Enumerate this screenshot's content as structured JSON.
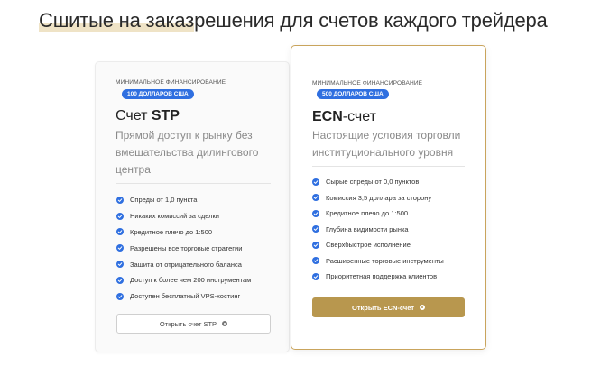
{
  "headline": {
    "highlight": "Сшитые на заказ",
    "rest": "решения для счетов каждого трейдера"
  },
  "cards": {
    "stp": {
      "min_label": "МИНИМАЛЬНОЕ ФИНАНСИРОВАНИЕ",
      "badge": "100 ДОЛЛАРОВ США",
      "title_prefix": "Счет ",
      "title_bold": "STP",
      "subtitle": "Прямой доступ к рынку без вмешательства дилингового центра",
      "features": [
        "Спреды от 1,0 пункта",
        "Никаких комиссий за сделки",
        "Кредитное плечо до 1:500",
        "Разрешены все торговые стратегии",
        "Защита от отрицательного баланса",
        "Доступ к более чем 200 инструментам",
        "Доступен бесплатный VPS-хостинг"
      ],
      "button": "Открыть счет STP"
    },
    "ecn": {
      "min_label": "МИНИМАЛЬНОЕ ФИНАНСИРОВАНИЕ",
      "badge": "500 ДОЛЛАРОВ США",
      "title_bold": "ECN",
      "title_suffix": "-счет",
      "subtitle": "Настоящие условия торговли институционального уровня",
      "features": [
        "Сырые спреды от 0,0 пунктов",
        "Комиссия 3,5 доллара за сторону",
        "Кредитное плечо до 1:500",
        "Глубина видимости рынка",
        "Сверхбыстрое исполнение",
        "Расширенные торговые инструменты",
        "Приоритетная поддержка клиентов"
      ],
      "button": "Открыть ECN-счет"
    }
  },
  "colors": {
    "accent_blue": "#2f6fe0",
    "gold": "#b8974e",
    "highlight": "#efe3c6"
  },
  "icons": {
    "feature": "check-circle-icon",
    "button": "info-icon"
  }
}
